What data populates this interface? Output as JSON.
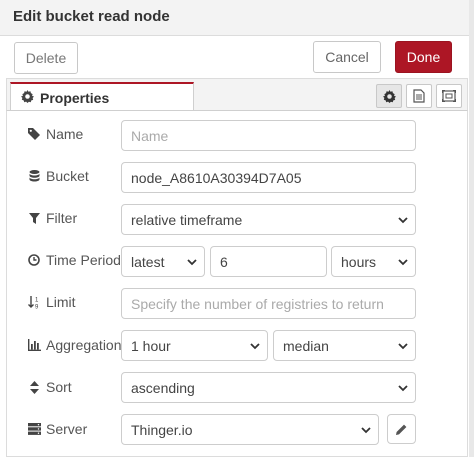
{
  "header": {
    "title": "Edit bucket read node"
  },
  "toolbar": {
    "delete_label": "Delete",
    "cancel_label": "Cancel",
    "done_label": "Done"
  },
  "tabs": {
    "properties_label": "Properties"
  },
  "form": {
    "name": {
      "label": "Name",
      "placeholder": "Name",
      "value": ""
    },
    "bucket": {
      "label": "Bucket",
      "value": "node_A8610A30394D7A05"
    },
    "filter": {
      "label": "Filter",
      "value": "relative timeframe"
    },
    "time_period": {
      "label": "Time Period",
      "mode": "latest",
      "amount": "6",
      "unit": "hours"
    },
    "limit": {
      "label": "Limit",
      "placeholder": "Specify the number of registries to return",
      "value": ""
    },
    "aggregation": {
      "label": "Aggregation",
      "interval": "1 hour",
      "function": "median"
    },
    "sort": {
      "label": "Sort",
      "value": "ascending"
    },
    "server": {
      "label": "Server",
      "value": "Thinger.io"
    }
  },
  "colors": {
    "accent": "#ad1625",
    "header_bg": "#f3f3f3",
    "border": "#cdcdcd"
  }
}
